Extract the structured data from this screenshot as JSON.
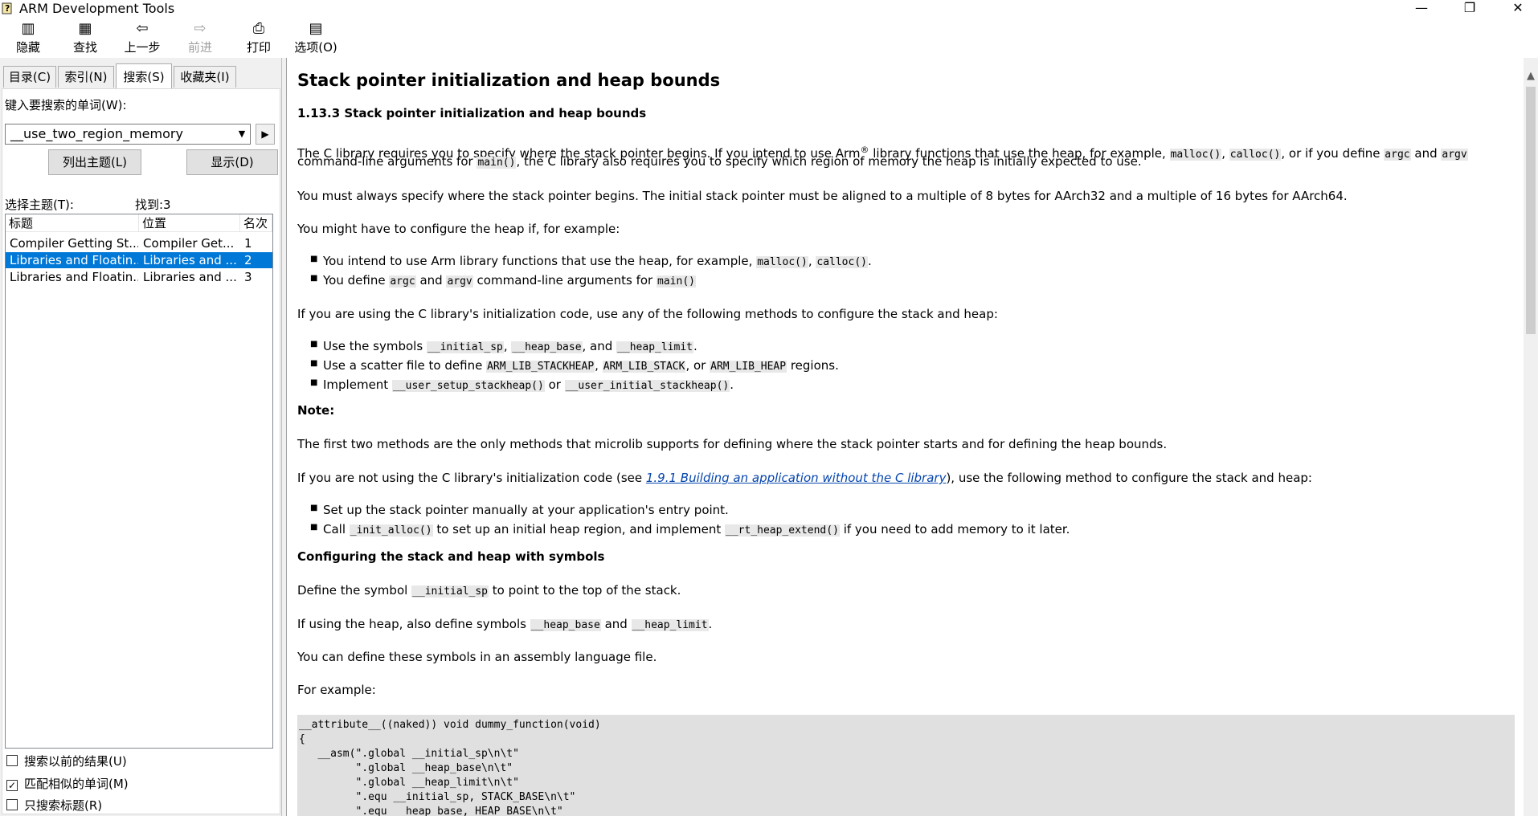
{
  "window": {
    "title": "ARM Development Tools",
    "min": "—",
    "max": "❐",
    "close": "✕"
  },
  "toolbar": {
    "hide": "隐藏",
    "find": "查找",
    "back": "上一步",
    "forward": "前进",
    "print": "打印",
    "options": "选项(O)"
  },
  "tabs": {
    "contents": "目录(C)",
    "index": "索引(N)",
    "search": "搜索(S)",
    "favorites": "收藏夹(I)"
  },
  "search": {
    "prompt": "键入要搜索的单词(W):",
    "query": "__use_two_region_memory",
    "list_topics": "列出主题(L)",
    "display": "显示(D)",
    "select_topic": "选择主题(T):",
    "found": "找到:3",
    "col_title": "标题",
    "col_location": "位置",
    "col_rank": "名次",
    "results": [
      {
        "title": "Compiler Getting St...",
        "location": "Compiler Get...",
        "rank": "1"
      },
      {
        "title": "Libraries and Floatin...",
        "location": "Libraries and ...",
        "rank": "2"
      },
      {
        "title": "Libraries and Floatin...",
        "location": "Libraries and ...",
        "rank": "3"
      }
    ],
    "opt_prev": "搜索以前的结果(U)",
    "opt_similar": "匹配相似的单词(M)",
    "opt_titles": "只搜索标题(R)"
  },
  "doc": {
    "title": "Stack pointer initialization and heap bounds",
    "subtitle": "1.13.3 Stack pointer initialization and heap bounds",
    "p1a": "The C library requires you to specify where the stack pointer begins. If you intend to use Arm",
    "p1b": "library functions that use the heap, for example,",
    "p1c": ", or if you define",
    "p1d": "and",
    "p1e": "command-line arguments for",
    "p1f": ", the C library also requires you to specify which region of memory the heap is initially expected to use.",
    "p2": "You must always specify where the stack pointer begins. The initial stack pointer must be aligned to a multiple of 8 bytes for AArch32 and a multiple of 16 bytes for AArch64.",
    "p3": "You might have to configure the heap if, for example:",
    "b1a": "You intend to use Arm library functions that use the heap, for example,",
    "b2a": "You define",
    "b2b": "and",
    "b2c": "command-line arguments for",
    "p4": "If you are using the C library's initialization code, use any of the following methods to configure the stack and heap:",
    "b3a": "Use the symbols",
    "b3b": ", and",
    "b4a": "Use a scatter file to define",
    "b4b": ", or",
    "b4c": "regions.",
    "b5a": "Implement",
    "b5b": "or",
    "note": "Note:",
    "p5": "The first two methods are the only methods that microlib supports for defining where the stack pointer starts and for defining the heap bounds.",
    "p6a": "If you are not using the C library's initialization code (see",
    "p6link": "1.9.1 Building an application without the C library",
    "p6b": "), use the following method to configure the stack and heap:",
    "b6": "Set up the stack pointer manually at your application's entry point.",
    "b7a": "Call",
    "b7b": "to set up an initial heap region, and implement",
    "b7c": "if you need to add memory to it later.",
    "h3": "Configuring the stack and heap with symbols",
    "p7a": "Define the symbol",
    "p7b": "to point to the top of the stack.",
    "p8a": "If using the heap, also define symbols",
    "p8b": "and",
    "p9": "You can define these symbols in an assembly language file.",
    "p10": "For example:",
    "code": {
      "malloc": "malloc()",
      "calloc": "calloc()",
      "argc": "argc",
      "argv": "argv",
      "main": "main()",
      "initial_sp": "__initial_sp",
      "heap_base": "__heap_base",
      "heap_limit": "__heap_limit",
      "stackheap": "ARM_LIB_STACKHEAP",
      "stack": "ARM_LIB_STACK",
      "heap": "ARM_LIB_HEAP",
      "user_setup": "__user_setup_stackheap()",
      "user_initial": "__user_initial_stackheap()",
      "init_alloc": "_init_alloc()",
      "rt_heap_extend": "__rt_heap_extend()"
    },
    "pre": "__attribute__((naked)) void dummy_function(void)\n{\n   __asm(\".global __initial_sp\\n\\t\"\n         \".global __heap_base\\n\\t\"\n         \".global __heap_limit\\n\\t\"\n         \".equ __initial_sp, STACK_BASE\\n\\t\"\n         \".equ __heap_base, HEAP_BASE\\n\\t\""
  }
}
